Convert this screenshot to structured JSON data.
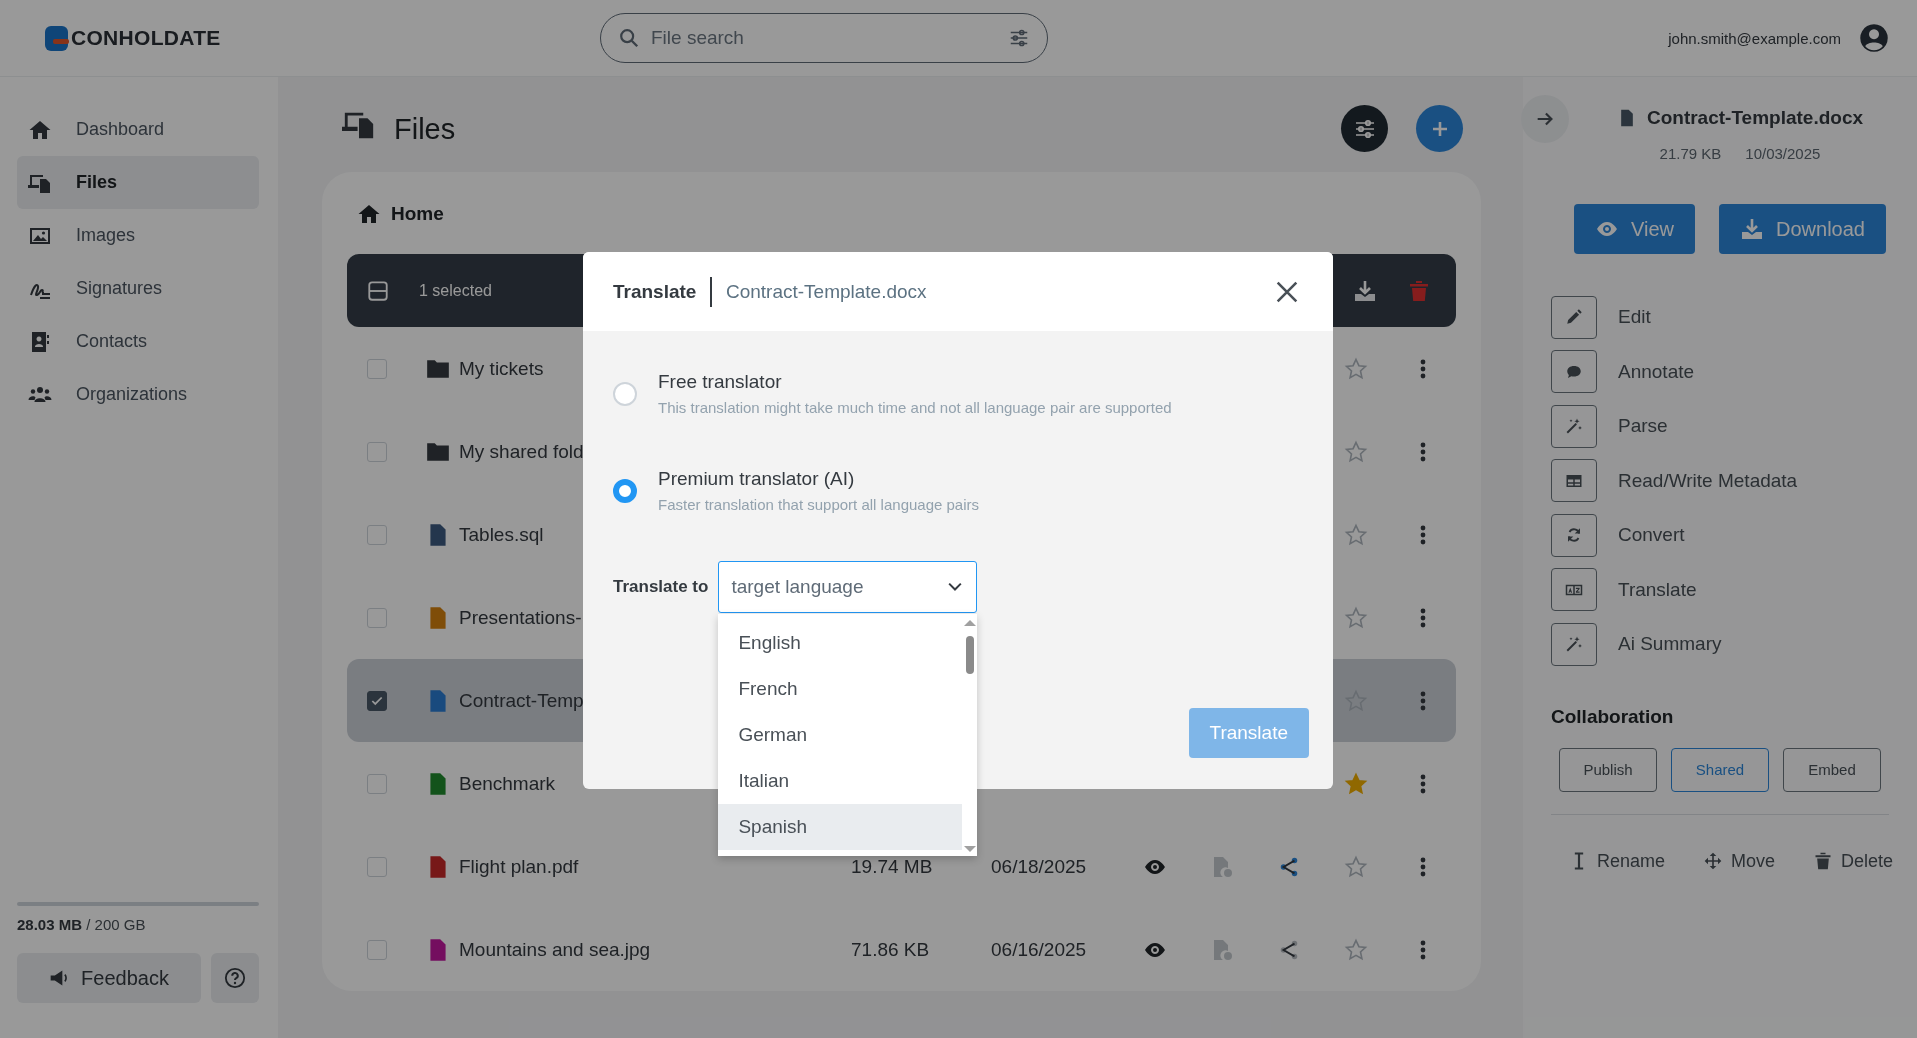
{
  "header": {
    "logo": "CONHOLDATE",
    "search": {
      "placeholder": "File search"
    },
    "user_email": "john.smith@example.com"
  },
  "sidebar": {
    "items": [
      {
        "label": "Dashboard",
        "selected": false
      },
      {
        "label": "Files",
        "selected": true
      },
      {
        "label": "Images",
        "selected": false
      },
      {
        "label": "Signatures",
        "selected": false
      },
      {
        "label": "Contacts",
        "selected": false
      },
      {
        "label": "Organizations",
        "selected": false
      }
    ],
    "storage": "**28.03 MB** / 200 GB",
    "feedback": "Feedback"
  },
  "page": {
    "title": "Files",
    "breadcrumb": "Home",
    "selection": "1 selected"
  },
  "rows": [
    {
      "name": "My tickets",
      "kind": "folder",
      "checked": false,
      "starred": false
    },
    {
      "name": "My shared fold",
      "kind": "folder",
      "checked": false,
      "starred": false
    },
    {
      "name": "Tables.sql",
      "kind": "code",
      "checked": false,
      "starred": false
    },
    {
      "name": "Presentations-",
      "kind": "slides",
      "checked": false,
      "starred": false
    },
    {
      "name": "Contract-Temp",
      "kind": "word",
      "checked": true,
      "starred": false
    },
    {
      "name": "Benchmark",
      "kind": "sheet",
      "checked": false,
      "starred": true
    },
    {
      "name": "Flight plan.pdf",
      "kind": "pdf",
      "checked": false,
      "starred": false,
      "size": "19.74 MB",
      "date": "06/18/2025",
      "shared": true
    },
    {
      "name": "Mountains and sea.jpg",
      "kind": "image",
      "checked": false,
      "starred": false,
      "size": "71.86 KB",
      "date": "06/16/2025",
      "shared": false
    }
  ],
  "details": {
    "file": "Contract-Template.docx",
    "size": "21.79 KB",
    "date": "10/03/2025",
    "buttons": [
      "View",
      "Download"
    ],
    "actions": [
      "Edit",
      "Annotate",
      "Parse",
      "Read/Write Metadata",
      "Convert",
      "Translate",
      "Ai Summary"
    ],
    "collaboration": {
      "title": "Collaboration",
      "buttons": [
        {
          "label": "Publish",
          "selected": false
        },
        {
          "label": "Shared",
          "selected": true
        },
        {
          "label": "Embed",
          "selected": false
        }
      ]
    },
    "footer": [
      "Rename",
      "Move",
      "Delete"
    ]
  },
  "dialog": {
    "title": "Translate",
    "file": "Contract-Template.docx",
    "options": [
      {
        "label": "Free translator",
        "description": "This translation might take much time and not all language pair are supported",
        "selected": false
      },
      {
        "label": "Premium translator (AI)",
        "description": "Faster translation that support all language pairs",
        "selected": true
      }
    ],
    "target_label": "Translate to",
    "select": {
      "placeholder": "target language"
    },
    "languages": [
      {
        "label": "English",
        "selected": false
      },
      {
        "label": "French",
        "selected": false
      },
      {
        "label": "German",
        "selected": false
      },
      {
        "label": "Italian",
        "selected": false
      },
      {
        "label": "Spanish",
        "selected": true
      }
    ],
    "submit": {
      "label": "Translate",
      "disabled": true
    }
  }
}
